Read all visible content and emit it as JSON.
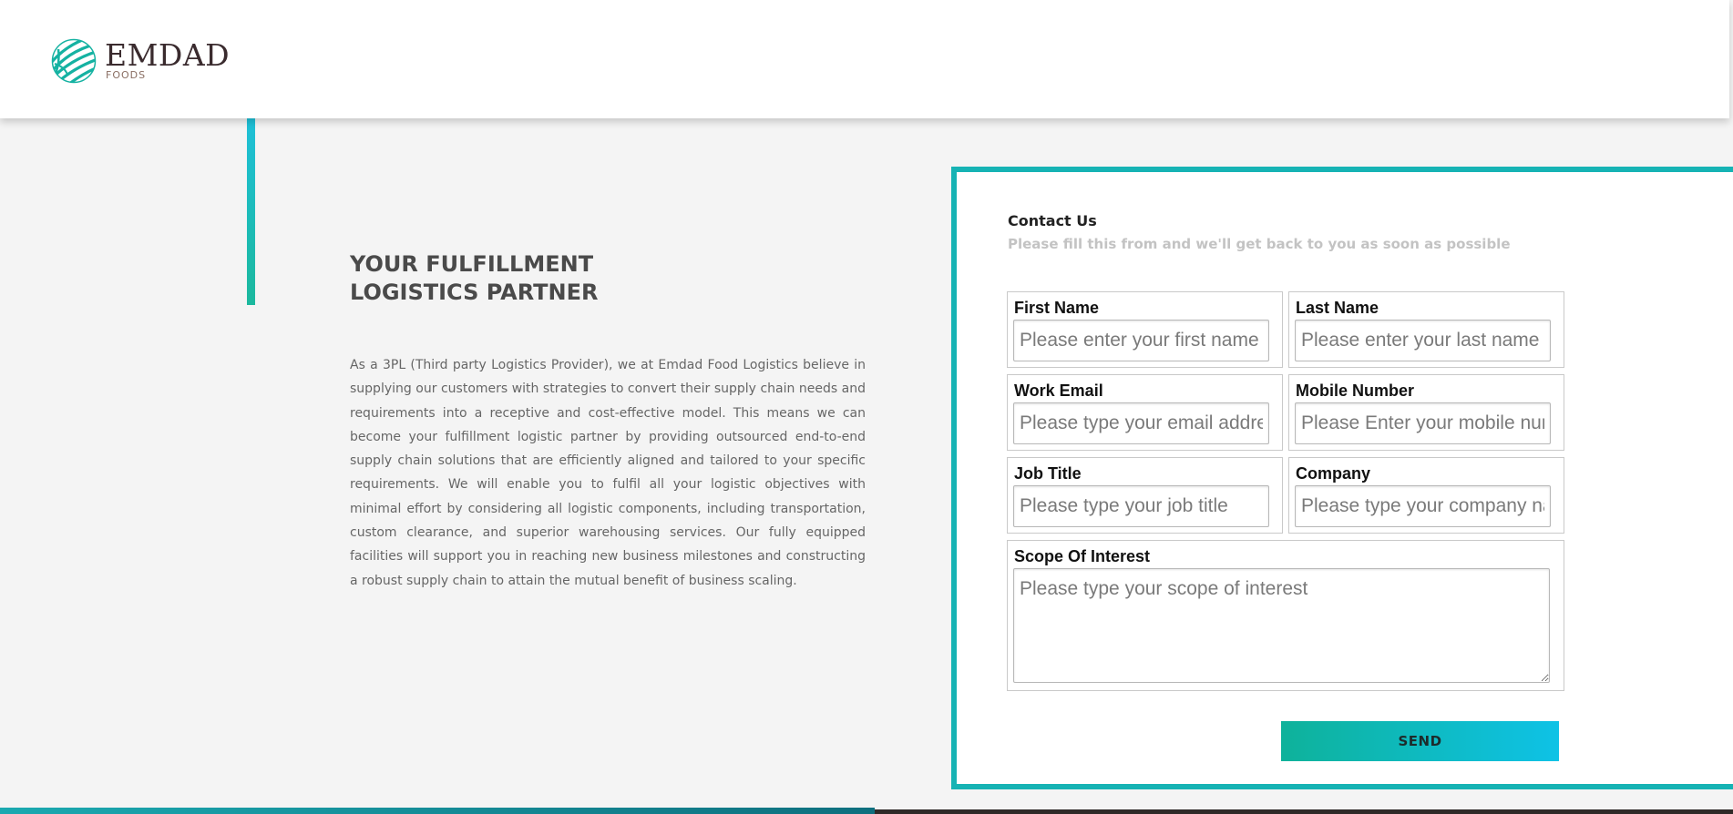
{
  "brand": {
    "name": "EMDAD",
    "sub": "FOODS",
    "colors": {
      "primary": "#16b3b4",
      "word": "#3a2b2e",
      "sub": "#8a6e63"
    }
  },
  "hero": {
    "headline_line1": "YOUR FULFILLMENT",
    "headline_line2": "LOGISTICS PARTNER",
    "body": "As a 3PL (Third party Logistics Provider), we at Emdad Food Logistics believe in supplying our customers with strategies to convert their supply chain needs and requirements into a receptive and cost-effective model. This means we can become your fulfillment logistic partner by providing outsourced end-to-end supply chain solutions that are efficiently aligned and tailored to your specific requirements. We will enable you to fulfil all your logistic objectives with minimal effort by considering all logistic components, including transportation, custom clearance, and superior warehousing services. Our fully equipped facilities will support you in reaching new business milestones and constructing a robust supply chain to attain the mutual benefit of business scaling."
  },
  "contact": {
    "title": "Contact Us",
    "subtitle": "Please fill this from and we'll get back to you as soon as possible",
    "fields": {
      "first_name": {
        "label": "First Name",
        "placeholder": "Please enter your first name",
        "value": ""
      },
      "last_name": {
        "label": "Last Name",
        "placeholder": "Please enter your last name",
        "value": ""
      },
      "work_email": {
        "label": "Work Email",
        "placeholder": "Please type your email address",
        "value": ""
      },
      "mobile_number": {
        "label": "Mobile Number",
        "placeholder": "Please Enter your mobile number",
        "value": ""
      },
      "job_title": {
        "label": "Job Title",
        "placeholder": "Please type your job title",
        "value": ""
      },
      "company": {
        "label": "Company",
        "placeholder": "Please type your company name",
        "value": ""
      },
      "scope": {
        "label": "Scope Of Interest",
        "placeholder": "Please type your scope of interest",
        "value": ""
      }
    },
    "send_label": "SEND",
    "colors": {
      "button_from": "#0eb29a",
      "button_to": "#0ec2e6",
      "border": "#16b3b4"
    }
  },
  "icons": {
    "logo_mark": "leaf-globe-icon",
    "resize_handle": "resize-grip-icon"
  }
}
